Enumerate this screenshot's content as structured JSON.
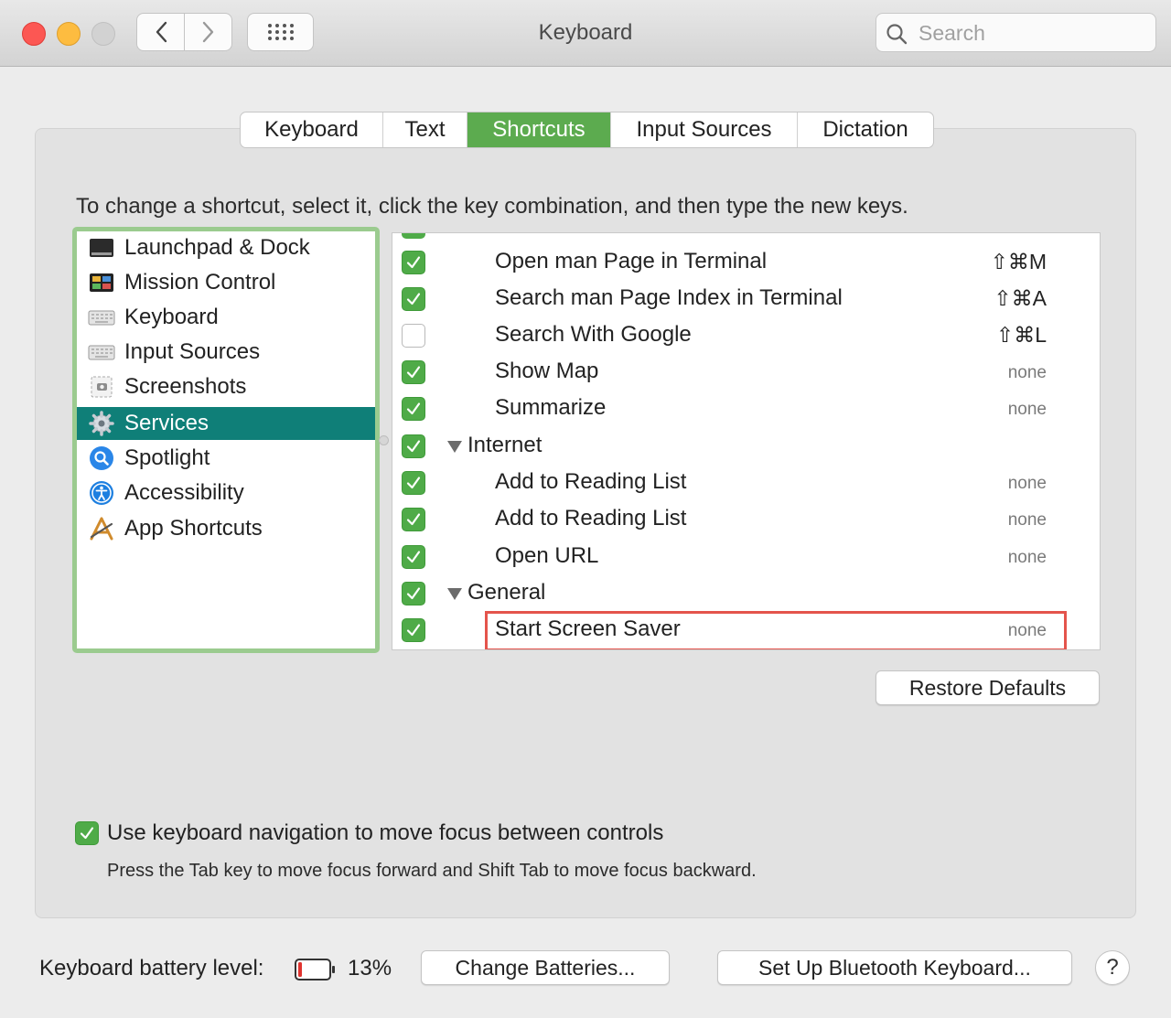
{
  "window": {
    "title": "Keyboard"
  },
  "search": {
    "placeholder": "Search"
  },
  "tabs": [
    {
      "label": "Keyboard",
      "active": false
    },
    {
      "label": "Text",
      "active": false
    },
    {
      "label": "Shortcuts",
      "active": true
    },
    {
      "label": "Input Sources",
      "active": false
    },
    {
      "label": "Dictation",
      "active": false
    }
  ],
  "instructions": "To change a shortcut, select it, click the key combination, and then type the new keys.",
  "categories": [
    {
      "label": "Launchpad & Dock",
      "icon": "launchpad-dock-icon",
      "selected": false
    },
    {
      "label": "Mission Control",
      "icon": "mission-control-icon",
      "selected": false
    },
    {
      "label": "Keyboard",
      "icon": "keyboard-icon",
      "selected": false
    },
    {
      "label": "Input Sources",
      "icon": "input-sources-icon",
      "selected": false
    },
    {
      "label": "Screenshots",
      "icon": "screenshots-icon",
      "selected": false
    },
    {
      "label": "Services",
      "icon": "gear-icon",
      "selected": true
    },
    {
      "label": "Spotlight",
      "icon": "spotlight-icon",
      "selected": false
    },
    {
      "label": "Accessibility",
      "icon": "accessibility-icon",
      "selected": false
    },
    {
      "label": "App Shortcuts",
      "icon": "app-shortcuts-icon",
      "selected": false
    }
  ],
  "shortcuts": [
    {
      "label": "Open man Page in Terminal",
      "checked": true,
      "key": "⇧⌘M",
      "group": false
    },
    {
      "label": "Search man Page Index in Terminal",
      "checked": true,
      "key": "⇧⌘A",
      "group": false
    },
    {
      "label": "Search With Google",
      "checked": false,
      "key": "⇧⌘L",
      "group": false
    },
    {
      "label": "Show Map",
      "checked": true,
      "key": "none",
      "group": false
    },
    {
      "label": "Summarize",
      "checked": true,
      "key": "none",
      "group": false
    },
    {
      "label": "Internet",
      "checked": true,
      "key": "",
      "group": true
    },
    {
      "label": "Add to Reading List",
      "checked": true,
      "key": "none",
      "group": false
    },
    {
      "label": "Add to Reading List",
      "checked": true,
      "key": "none",
      "group": false
    },
    {
      "label": "Open URL",
      "checked": true,
      "key": "none",
      "group": false
    },
    {
      "label": "General",
      "checked": true,
      "key": "",
      "group": true
    },
    {
      "label": "Start Screen Saver",
      "checked": true,
      "key": "none",
      "group": false,
      "highlighted": true
    }
  ],
  "buttons": {
    "restore_defaults": "Restore Defaults",
    "change_batteries": "Change Batteries...",
    "setup_bluetooth": "Set Up Bluetooth Keyboard...",
    "help": "?"
  },
  "keyboard_navigation": {
    "checked": true,
    "label": "Use keyboard navigation to move focus between controls",
    "hint": "Press the Tab key to move focus forward and Shift Tab to move focus backward."
  },
  "battery": {
    "label": "Keyboard battery level:",
    "percent_text": "13%",
    "level": 0.13,
    "color": "#e0332f"
  },
  "colors": {
    "accent": "#5cab4f",
    "selection": "#0f7f78",
    "checkbox": "#4fab48",
    "highlight_border": "#e4544c"
  }
}
